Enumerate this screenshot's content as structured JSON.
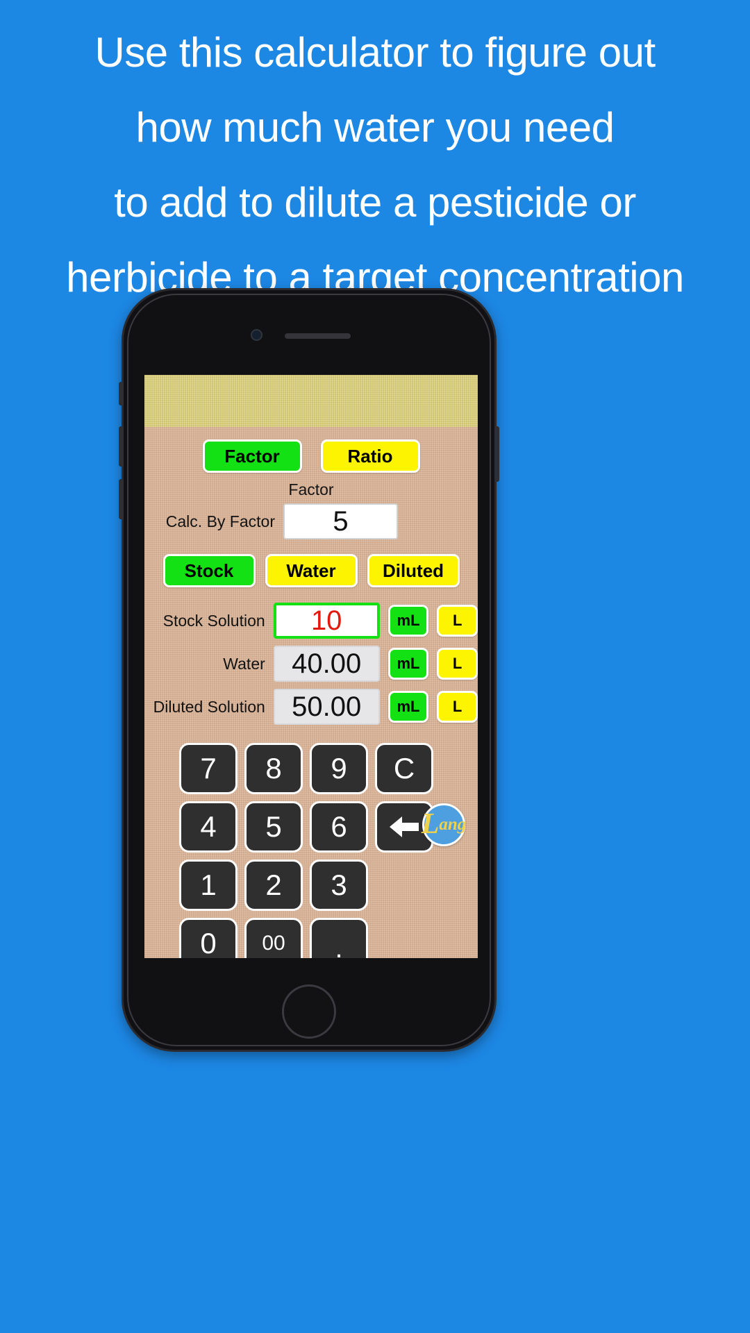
{
  "headline": {
    "lines": [
      "Use this calculator to figure out",
      "how much water you need",
      "to add to dilute a pesticide or",
      "herbicide to a target concentration"
    ]
  },
  "colors": {
    "background": "#1d87e4",
    "accent_green": "#14e114",
    "accent_yellow": "#fcf400",
    "value_red": "#e01b0d",
    "screen_bg": "#dcb69a",
    "screen_band": "#ddd382",
    "key_bg": "#2f2f2f"
  },
  "app": {
    "mode_tabs": [
      {
        "label": "Factor",
        "selected": true,
        "color": "green"
      },
      {
        "label": "Ratio",
        "selected": false,
        "color": "yellow"
      }
    ],
    "section_caption": "Factor",
    "factor_row": {
      "label": "Calc. By Factor",
      "value": "5"
    },
    "type_tabs": [
      {
        "label": "Stock",
        "selected": true,
        "color": "green"
      },
      {
        "label": "Water",
        "selected": false,
        "color": "yellow"
      },
      {
        "label": "Diluted",
        "selected": false,
        "color": "yellow"
      }
    ],
    "rows": [
      {
        "label": "Stock Solution",
        "value": "10",
        "state": "active",
        "units": [
          {
            "label": "mL",
            "selected": true,
            "color": "green"
          },
          {
            "label": "L",
            "selected": false,
            "color": "yellow"
          }
        ]
      },
      {
        "label": "Water",
        "value": "40.00",
        "state": "readonly",
        "units": [
          {
            "label": "mL",
            "selected": true,
            "color": "green"
          },
          {
            "label": "L",
            "selected": false,
            "color": "yellow"
          }
        ]
      },
      {
        "label": "Diluted Solution",
        "value": "50.00",
        "state": "readonly",
        "units": [
          {
            "label": "mL",
            "selected": true,
            "color": "green"
          },
          {
            "label": "L",
            "selected": false,
            "color": "yellow"
          }
        ]
      }
    ],
    "keypad": [
      {
        "label": "7",
        "name": "key-7"
      },
      {
        "label": "8",
        "name": "key-8"
      },
      {
        "label": "9",
        "name": "key-9"
      },
      {
        "label": "C",
        "name": "key-clear"
      },
      {
        "label": "4",
        "name": "key-4"
      },
      {
        "label": "5",
        "name": "key-5"
      },
      {
        "label": "6",
        "name": "key-6"
      },
      {
        "label": "",
        "name": "key-backspace",
        "icon": "backspace-arrow-icon"
      },
      {
        "label": "1",
        "name": "key-1"
      },
      {
        "label": "2",
        "name": "key-2"
      },
      {
        "label": "3",
        "name": "key-3"
      },
      {
        "label": "",
        "name": "key-blank"
      },
      {
        "label": "0",
        "name": "key-0"
      },
      {
        "label": "00",
        "name": "key-double-zero"
      },
      {
        "label": ".",
        "name": "key-decimal"
      },
      {
        "label": "",
        "name": "key-blank-2"
      }
    ],
    "logo": {
      "initial": "L",
      "rest": "ang"
    }
  }
}
